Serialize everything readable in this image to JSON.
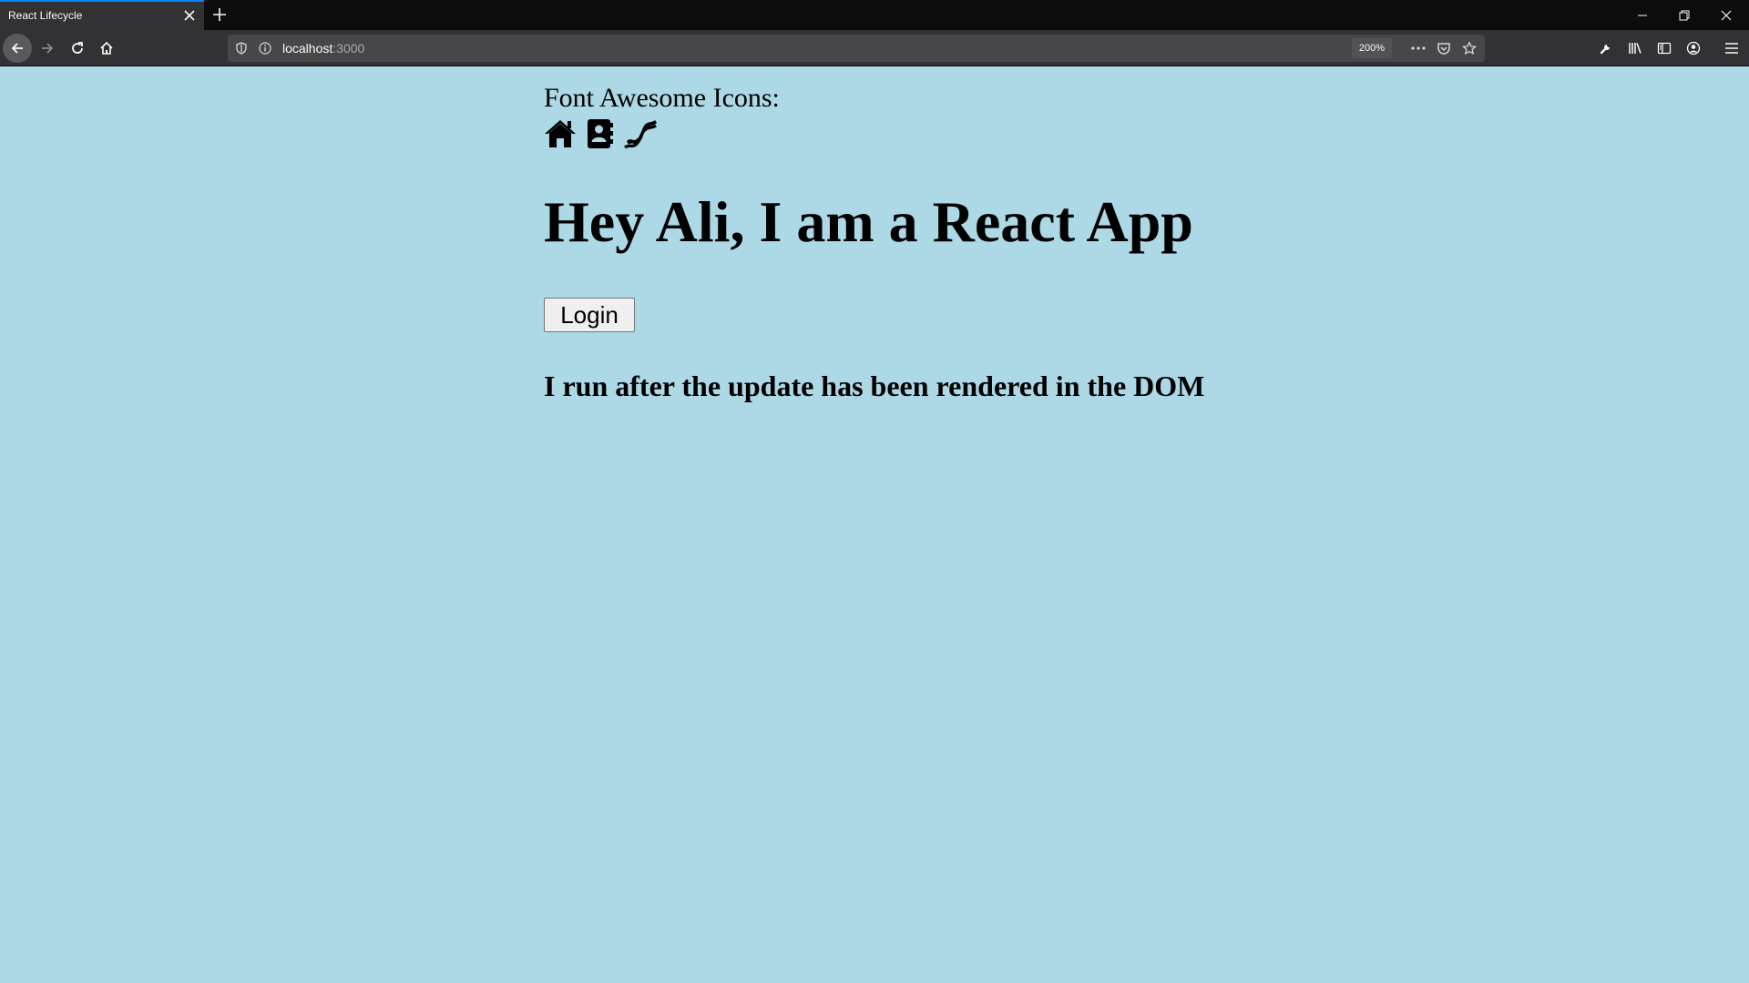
{
  "browser": {
    "tab": {
      "title": "React Lifecycle"
    },
    "url": {
      "host": "localhost",
      "port": ":3000"
    },
    "zoom": "200%",
    "colors": {
      "tab_accent": "#0a84ff",
      "chrome_dark": "#0c0c0d",
      "toolbar": "#323234"
    }
  },
  "page": {
    "icons_label": "Font Awesome Icons:",
    "icons": [
      "home-icon",
      "address-book-icon",
      "bacon-icon"
    ],
    "headline": "Hey Ali, I am a React App",
    "login_label": "Login",
    "status_message": "I run after the update has been rendered in the DOM",
    "colors": {
      "background": "#add8e6"
    }
  }
}
